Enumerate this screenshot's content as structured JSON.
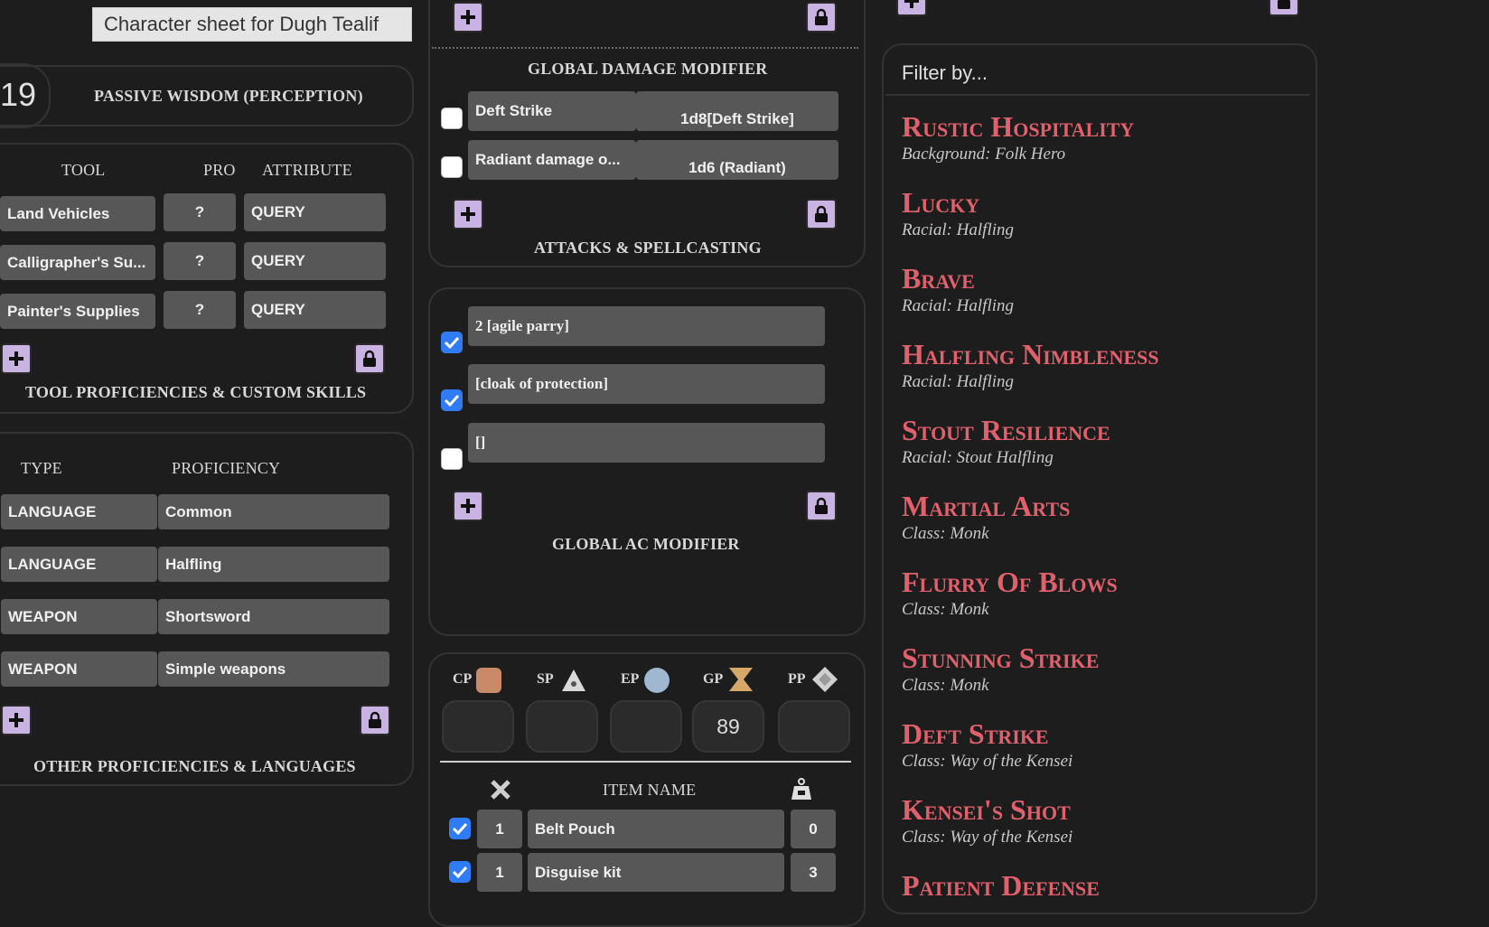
{
  "tooltip": "Character sheet for Dugh Tealif",
  "passive": {
    "value": "19",
    "label": "PASSIVE WISDOM (PERCEPTION)"
  },
  "tools": {
    "headers": {
      "tool": "TOOL",
      "pro": "PRO",
      "attribute": "ATTRIBUTE"
    },
    "rows": [
      {
        "name": "Land Vehicles",
        "pro": "?",
        "attr": "QUERY"
      },
      {
        "name": "Calligrapher's Su...",
        "pro": "?",
        "attr": "QUERY"
      },
      {
        "name": "Painter's Supplies",
        "pro": "?",
        "attr": "QUERY"
      }
    ],
    "title": "TOOL PROFICIENCIES & CUSTOM SKILLS"
  },
  "other": {
    "headers": {
      "type": "TYPE",
      "proficiency": "PROFICIENCY"
    },
    "rows": [
      {
        "type": "LANGUAGE",
        "prof": "Common"
      },
      {
        "type": "LANGUAGE",
        "prof": "Halfling"
      },
      {
        "type": "WEAPON",
        "prof": "Shortsword"
      },
      {
        "type": "WEAPON",
        "prof": "Simple weapons"
      }
    ],
    "title": "OTHER PROFICIENCIES & LANGUAGES"
  },
  "damage": {
    "title": "GLOBAL DAMAGE MODIFIER",
    "rows": [
      {
        "name": "Deft Strike",
        "dice": "1d8[Deft Strike]",
        "checked": false
      },
      {
        "name": "Radiant damage o...",
        "dice": "1d6 (Radiant)",
        "checked": false
      }
    ],
    "section_title": "ATTACKS & SPELLCASTING"
  },
  "ac": {
    "rows": [
      {
        "value": "2 [agile parry]",
        "checked": true
      },
      {
        "value": "[cloak of protection]",
        "checked": true
      },
      {
        "value": "[]",
        "checked": false
      }
    ],
    "title": "GLOBAL AC MODIFIER"
  },
  "coins": [
    {
      "label": "CP",
      "value": "",
      "icon": "copper-coin-icon",
      "color": "#c98a6a"
    },
    {
      "label": "SP",
      "value": "",
      "icon": "silver-coin-icon",
      "color": "#d9d9d9"
    },
    {
      "label": "EP",
      "value": "",
      "icon": "electrum-coin-icon",
      "color": "#9fb7d0"
    },
    {
      "label": "GP",
      "value": "89",
      "icon": "gold-coin-icon",
      "color": "#d6a868"
    },
    {
      "label": "PP",
      "value": "",
      "icon": "platinum-coin-icon",
      "color": "#cfcfcf"
    }
  ],
  "items": {
    "header": "ITEM NAME",
    "rows": [
      {
        "checked": true,
        "qty": "1",
        "name": "Belt Pouch",
        "weight": "0"
      },
      {
        "checked": true,
        "qty": "1",
        "name": "Disguise kit",
        "weight": "3"
      }
    ]
  },
  "features": {
    "filter_placeholder": "Filter by...",
    "list": [
      {
        "title": "Rustic Hospitality",
        "source": "Background: Folk Hero"
      },
      {
        "title": "Lucky",
        "source": "Racial: Halfling"
      },
      {
        "title": "Brave",
        "source": "Racial: Halfling"
      },
      {
        "title": "Halfling Nimbleness",
        "source": "Racial: Halfling"
      },
      {
        "title": "Stout Resilience",
        "source": "Racial: Stout Halfling"
      },
      {
        "title": "Martial Arts",
        "source": "Class: Monk"
      },
      {
        "title": "Flurry Of Blows",
        "source": "Class: Monk"
      },
      {
        "title": "Stunning Strike",
        "source": "Class: Monk"
      },
      {
        "title": "Deft Strike",
        "source": "Class: Way of the Kensei"
      },
      {
        "title": "Kensei's Shot",
        "source": "Class: Way of the Kensei"
      },
      {
        "title": "Patient Defense",
        "source": ""
      }
    ]
  },
  "colors": {
    "accent_button": "#c9b3e2",
    "feature_title": "#e0606c",
    "field_bg": "#575757",
    "checkbox_on": "#2f7cf6"
  }
}
